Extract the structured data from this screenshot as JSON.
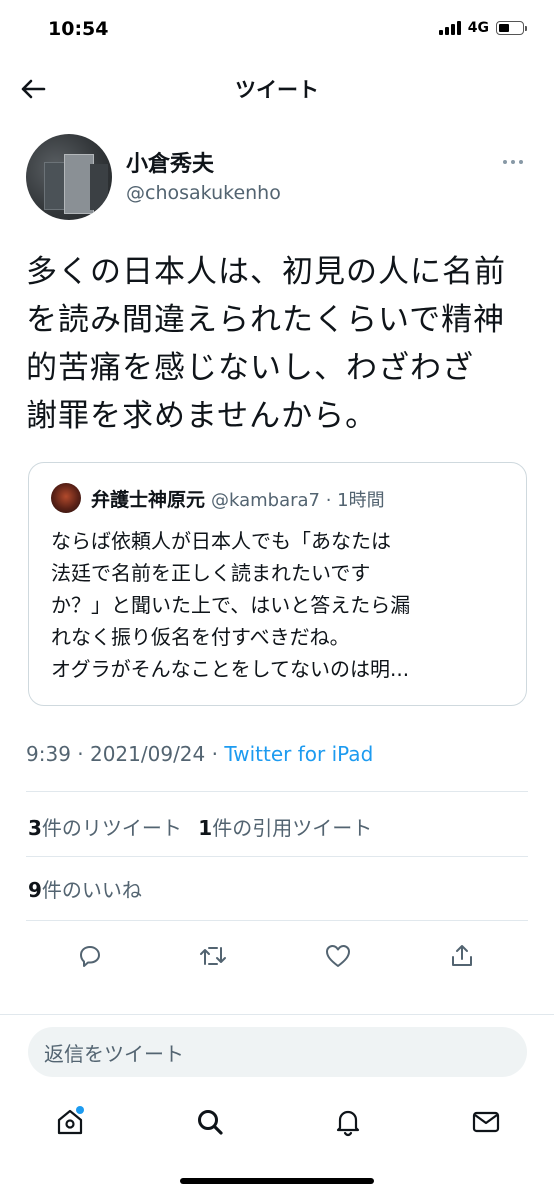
{
  "status_bar": {
    "time": "10:54",
    "network": "4G",
    "battery_level": 0.45
  },
  "header": {
    "title": "ツイート",
    "back_icon": "arrow-left-icon"
  },
  "tweet": {
    "display_name": "小倉秀夫",
    "handle": "@chosakukenho",
    "text": "多くの日本人は、初見の人に名前\nを読み間違えられたくらいで精神\n的苦痛を感じないし、わざわざ\n謝罪を求めませんから。",
    "quote": {
      "display_name": "弁護士神原元",
      "meta": "@kambara7 · 1時間",
      "text": "ならば依頼人が日本人でも「あなたは\n法廷で名前を正しく読まれたいです\nか？」と聞いた上で、はいと答えたら漏\nれなく振り仮名を付すべきだね。\nオグラがそんなことをしてないのは明..."
    },
    "timestamp": "9:39 · 2021/09/24 · ",
    "source": "Twitter for iPad",
    "stats": {
      "retweet_count": "3",
      "retweet_label": "件のリツイート",
      "quote_count": "1",
      "quote_label": "件の引用ツイート",
      "like_count": "9",
      "like_label": "件のいいね"
    }
  },
  "actions": [
    "reply-icon",
    "retweet-icon",
    "like-icon",
    "share-icon"
  ],
  "reply_box": {
    "placeholder": "返信をツイート"
  },
  "tabbar": [
    "home-icon",
    "search-icon",
    "notifications-icon",
    "messages-icon"
  ],
  "colors": {
    "accent": "#1d9bf0",
    "secondary_text": "#536471",
    "divider": "#e1e8ed"
  }
}
